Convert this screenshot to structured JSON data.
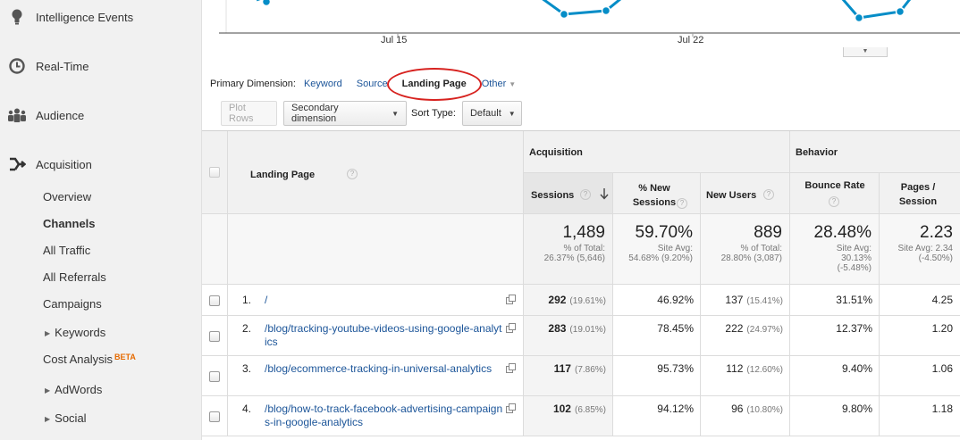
{
  "sidebar": {
    "main_items": [
      {
        "label": "Intelligence Events",
        "icon": "lightbulb-icon"
      },
      {
        "label": "Real-Time",
        "icon": "clock-icon"
      },
      {
        "label": "Audience",
        "icon": "people-icon"
      },
      {
        "label": "Acquisition",
        "icon": "acquisition-arrows-icon"
      }
    ],
    "sub_items": [
      {
        "label": "Overview"
      },
      {
        "label": "Channels"
      },
      {
        "label": "All Traffic"
      },
      {
        "label": "All Referrals"
      },
      {
        "label": "Campaigns"
      },
      {
        "label": "Keywords"
      },
      {
        "label": "Cost Analysis",
        "badge": "BETA"
      },
      {
        "label": "AdWords"
      },
      {
        "label": "Social"
      }
    ]
  },
  "chart": {
    "date_labels": [
      "Jul 15",
      "Jul 22"
    ],
    "line_color": "#058dc7"
  },
  "primary_dimension": {
    "label": "Primary Dimension:",
    "options": [
      "Keyword",
      "Source",
      "Landing Page",
      "Other"
    ],
    "selected": "Landing Page"
  },
  "toolbar": {
    "plot_rows": "Plot Rows",
    "secondary_dimension": "Secondary dimension",
    "sort_type_label": "Sort Type:",
    "sort_type_value": "Default"
  },
  "table": {
    "group_headers": [
      "Acquisition",
      "Behavior"
    ],
    "columns": {
      "landing_page": "Landing Page",
      "sessions": "Sessions",
      "pct_new_sessions": "% New Sessions",
      "new_users": "New Users",
      "bounce_rate": "Bounce Rate",
      "pages_session": "Pages / Session"
    },
    "totals": {
      "sessions": {
        "value": "1,489",
        "line1": "% of Total:",
        "line2": "26.37% (5,646)"
      },
      "pct_new_sessions": {
        "value": "59.70%",
        "line1": "Site Avg:",
        "line2": "54.68% (9.20%)"
      },
      "new_users": {
        "value": "889",
        "line1": "% of Total:",
        "line2": "28.80% (3,087)"
      },
      "bounce_rate": {
        "value": "28.48%",
        "line1": "Site Avg:",
        "line2": "30.13%",
        "line3": "(-5.48%)"
      },
      "pages_session": {
        "value": "2.23",
        "line1": "Site Avg: 2.34",
        "line2": "(-4.50%)"
      }
    },
    "rows": [
      {
        "num": "1.",
        "page": "/",
        "sessions": "292",
        "sessions_pct": "(19.61%)",
        "pct_new": "46.92%",
        "new_users": "137",
        "new_users_pct": "(15.41%)",
        "bounce": "31.51%",
        "pages": "4.25"
      },
      {
        "num": "2.",
        "page": "/blog/tracking-youtube-videos-using-google-analytics",
        "sessions": "283",
        "sessions_pct": "(19.01%)",
        "pct_new": "78.45%",
        "new_users": "222",
        "new_users_pct": "(24.97%)",
        "bounce": "12.37%",
        "pages": "1.20"
      },
      {
        "num": "3.",
        "page": "/blog/ecommerce-tracking-in-universal-analytics",
        "sessions": "117",
        "sessions_pct": "(7.86%)",
        "pct_new": "95.73%",
        "new_users": "112",
        "new_users_pct": "(12.60%)",
        "bounce": "9.40%",
        "pages": "1.06"
      },
      {
        "num": "4.",
        "page": "/blog/how-to-track-facebook-advertising-campaigns-in-google-analytics",
        "sessions": "102",
        "sessions_pct": "(6.85%)",
        "pct_new": "94.12%",
        "new_users": "96",
        "new_users_pct": "(10.80%)",
        "bounce": "9.80%",
        "pages": "1.18"
      }
    ]
  }
}
